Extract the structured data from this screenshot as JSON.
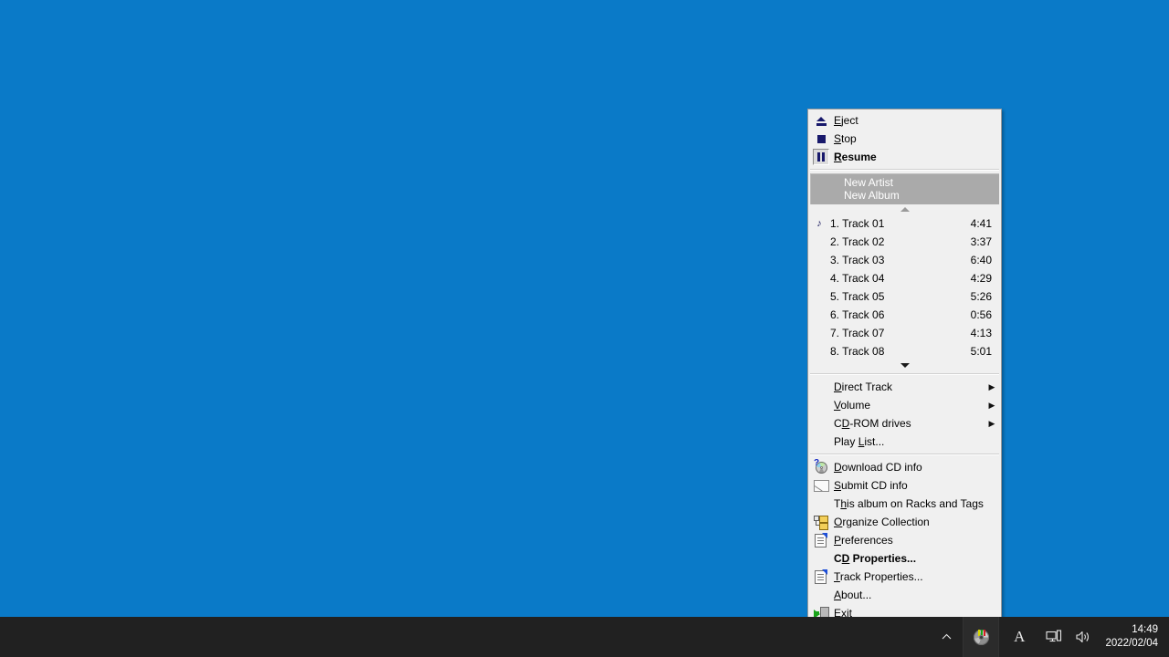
{
  "desktop": {
    "background_color": "#0a7ac8"
  },
  "taskbar": {
    "background_color": "#212121",
    "show_hidden_icons_label": "^",
    "tray_items": [
      {
        "name": "cd-player-tray-icon",
        "label": "CD Player"
      },
      {
        "name": "ime-indicator",
        "label": "A"
      },
      {
        "name": "network-icon",
        "label": "Network"
      },
      {
        "name": "volume-icon",
        "label": "Volume"
      }
    ],
    "clock": {
      "time": "14:49",
      "date": "2022/02/04"
    }
  },
  "menu": {
    "accent_icon_color": "#18196b",
    "highlight_color": "#aaaaaa",
    "controls": [
      {
        "id": "eject",
        "label": "Eject",
        "accel": "E",
        "icon": "eject-icon",
        "bold": false,
        "pressed": false
      },
      {
        "id": "stop",
        "label": "Stop",
        "accel": "S",
        "icon": "stop-icon",
        "bold": false,
        "pressed": false
      },
      {
        "id": "resume",
        "label": "Resume",
        "accel": "R",
        "icon": "pause-icon",
        "bold": true,
        "pressed": true
      }
    ],
    "album": {
      "artist": "New Artist",
      "title": "New Album"
    },
    "scroll_up_label": "Scroll up",
    "scroll_down_label": "Scroll down",
    "tracks": [
      {
        "num": "1.",
        "name": "Track 01",
        "time": "4:41",
        "playing": true
      },
      {
        "num": "2.",
        "name": "Track 02",
        "time": "3:37",
        "playing": false
      },
      {
        "num": "3.",
        "name": "Track 03",
        "time": "6:40",
        "playing": false
      },
      {
        "num": "4.",
        "name": "Track 04",
        "time": "4:29",
        "playing": false
      },
      {
        "num": "5.",
        "name": "Track 05",
        "time": "5:26",
        "playing": false
      },
      {
        "num": "6.",
        "name": "Track 06",
        "time": "0:56",
        "playing": false
      },
      {
        "num": "7.",
        "name": "Track 07",
        "time": "4:13",
        "playing": false
      },
      {
        "num": "8.",
        "name": "Track 08",
        "time": "5:01",
        "playing": false
      }
    ],
    "navigation": [
      {
        "id": "direct-track",
        "label": "Direct Track",
        "accel": "D",
        "submenu": true
      },
      {
        "id": "volume",
        "label": "Volume",
        "accel": "V",
        "submenu": true
      },
      {
        "id": "cd-rom-drives",
        "label": "CD-ROM drives",
        "accel": "D",
        "submenu": true
      },
      {
        "id": "play-list",
        "label": "Play List...",
        "accel": "L",
        "submenu": false
      }
    ],
    "actions": [
      {
        "id": "download-cd-info",
        "label": "Download CD info",
        "accel": "D",
        "icon": "cd-question-icon",
        "bold": false
      },
      {
        "id": "submit-cd-info",
        "label": "Submit CD info",
        "accel": "S",
        "icon": "envelope-icon",
        "bold": false
      },
      {
        "id": "album-racks-tags",
        "label": "This album on Racks and Tags",
        "accel": "h",
        "icon": "none",
        "bold": false
      },
      {
        "id": "organize-collection",
        "label": "Organize Collection",
        "accel": "O",
        "icon": "folder-tree-icon",
        "bold": false
      },
      {
        "id": "preferences",
        "label": "Preferences",
        "accel": "P",
        "icon": "properties-icon",
        "bold": false
      },
      {
        "id": "cd-properties",
        "label": "CD Properties...",
        "accel": "D",
        "icon": "none",
        "bold": true
      },
      {
        "id": "track-properties",
        "label": "Track Properties...",
        "accel": "T",
        "icon": "properties-icon",
        "bold": false
      },
      {
        "id": "about",
        "label": "About...",
        "accel": "A",
        "icon": "none",
        "bold": false
      },
      {
        "id": "exit",
        "label": "Exit",
        "accel": "x",
        "icon": "exit-icon",
        "bold": false
      }
    ],
    "submenu_arrow_glyph": "▶"
  }
}
